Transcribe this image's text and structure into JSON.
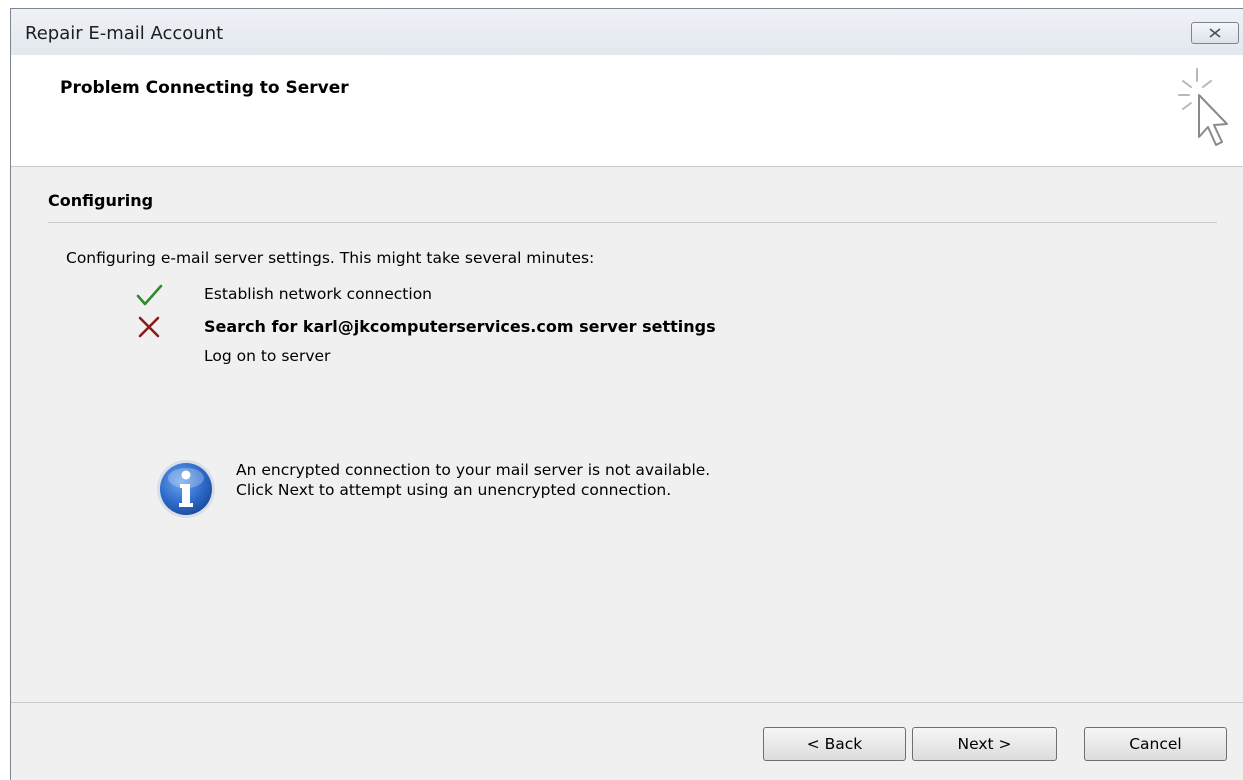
{
  "window": {
    "title": "Repair E-mail Account"
  },
  "banner": {
    "title": "Problem Connecting to Server",
    "icon": "cursor-sparkle-icon"
  },
  "section": {
    "title": "Configuring"
  },
  "intro": "Configuring e-mail server settings. This might take several minutes:",
  "steps": [
    {
      "label": "Establish network connection",
      "status": "done",
      "icon": "check-icon",
      "color": "#2e8b2e"
    },
    {
      "label": "Search for karl@jkcomputerservices.com server settings",
      "status": "failed",
      "icon": "x-icon",
      "color": "#8b1a1a"
    },
    {
      "label": "Log on to server",
      "status": "pending"
    }
  ],
  "info": {
    "icon": "info-icon",
    "line1": "An encrypted connection to your mail server is not available.",
    "line2": "Click Next to attempt using an unencrypted connection."
  },
  "buttons": {
    "back": "< Back",
    "next": "Next >",
    "cancel": "Cancel"
  }
}
